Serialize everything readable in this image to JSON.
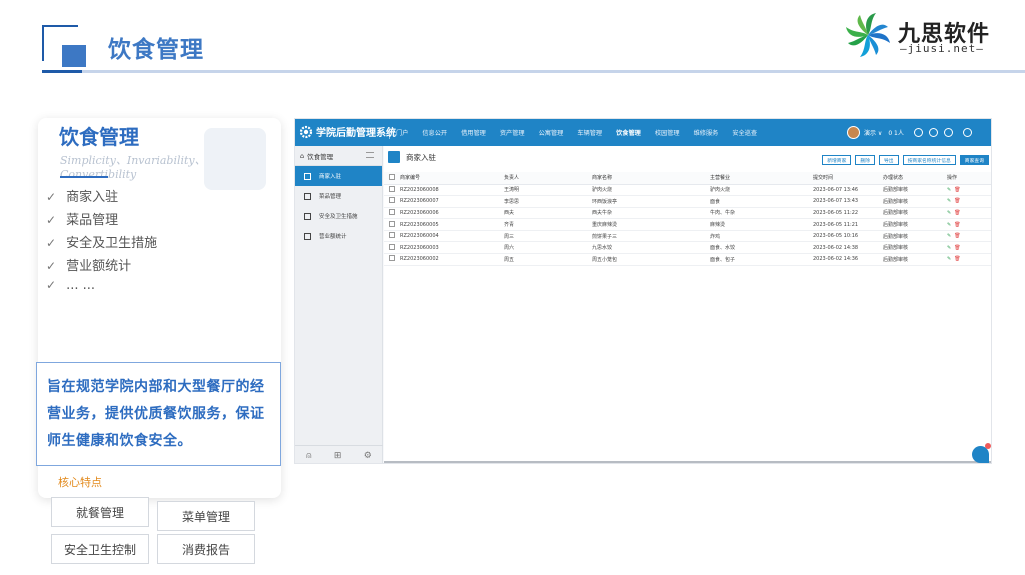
{
  "header": {
    "title": "饮食管理"
  },
  "logo": {
    "cn": "九思软件",
    "en": "—jiusi.net—"
  },
  "card": {
    "title": "饮食管理",
    "subtitle": "Simplicity、Invariability、Convertibility",
    "check_mark": "✓",
    "features": [
      "商家入驻",
      "菜品管理",
      "安全及卫生措施",
      "营业额统计",
      "... ..."
    ],
    "description": "旨在规范学院内部和大型餐厅的经营业务，提供优质餐饮服务，保证师生健康和饮食安全。",
    "core_label": "核心特点"
  },
  "tags": [
    "就餐管理",
    "菜单管理",
    "安全卫生控制",
    "消费报告"
  ],
  "app": {
    "brand": "学院后勤管理系统",
    "nav": [
      "门户",
      "信息公开",
      "借用管理",
      "资产管理",
      "公寓管理",
      "车辆管理",
      "饮食管理",
      "校园管理",
      "维修服务",
      "安全巡查"
    ],
    "active_nav": "饮食管理",
    "user": "演示 ∨",
    "online": "0 1人",
    "sidebar": {
      "title": "饮食管理",
      "items": [
        "商家入驻",
        "菜品管理",
        "安全及卫生措施",
        "营业额统计"
      ],
      "active_index": 0
    },
    "page_title": "商家入驻",
    "buttons": [
      "新增商家",
      "删除",
      "导出",
      "按商家名称统计信息",
      "商家查询"
    ],
    "columns": [
      "",
      "商家编号",
      "负责人",
      "商家名称",
      "主营餐业",
      "提交时间",
      "办理状态",
      "操作"
    ],
    "rows": [
      [
        "RZ2023060008",
        "王涛明",
        "驴肉火烧",
        "驴肉火烧",
        "2023-06-07 13:46",
        "后勤部审核"
      ],
      [
        "RZ2023060007",
        "李思思",
        "环西饭浪亭",
        "面食",
        "2023-06-07 13:43",
        "后勤部审核"
      ],
      [
        "RZ2023060006",
        "西夫",
        "西夫牛杂",
        "牛肉、牛杂",
        "2023-06-05 11:22",
        "后勤部审核"
      ],
      [
        "RZ2023060005",
        "齐青",
        "重庆麻辣烫",
        "麻辣烫",
        "2023-06-05 11:21",
        "后勤部审核"
      ],
      [
        "RZ2023060004",
        "周三",
        "煎饼果子三",
        "炸鸡",
        "2023-06-05 10:16",
        "后勤部审核"
      ],
      [
        "RZ2023060003",
        "周六",
        "九思水饺",
        "面食、水饺",
        "2023-06-02 14:38",
        "后勤部审核"
      ],
      [
        "RZ2023060002",
        "周五",
        "周五小笼包",
        "面食、包子",
        "2023-06-02 14:36",
        "后勤部审核"
      ]
    ],
    "edit_icon": "✎",
    "delete_icon": "🗑"
  },
  "colors": {
    "brand_blue": "#1f84c6",
    "accent": "#3d78c4",
    "core_orange": "#e2891b"
  }
}
